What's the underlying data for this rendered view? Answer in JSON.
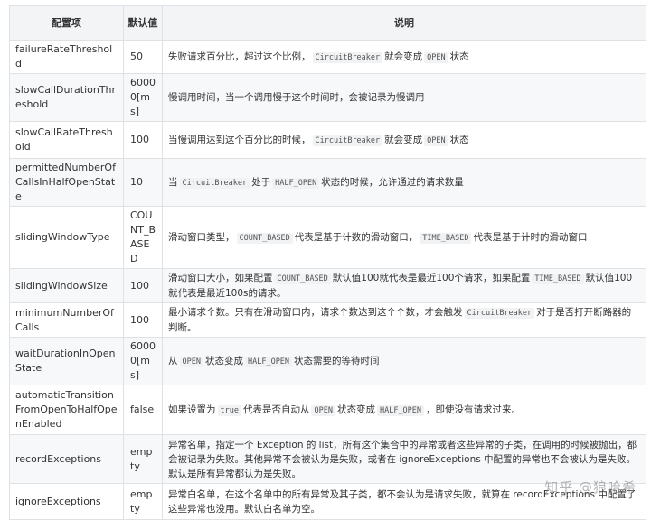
{
  "headers": {
    "name": "配置项",
    "default": "默认值",
    "desc": "说明"
  },
  "rows": [
    {
      "name": "failureRateThreshold",
      "default": "50",
      "desc": [
        {
          "t": "失败请求百分比，超过这个比例，"
        },
        {
          "c": "CircuitBreaker"
        },
        {
          "t": "就会变成"
        },
        {
          "c": "OPEN"
        },
        {
          "t": "状态"
        }
      ]
    },
    {
      "name": "slowCallDurationThreshold",
      "default": "60000[ms]",
      "desc": [
        {
          "t": "慢调用时间，当一个调用慢于这个时间时，会被记录为慢调用"
        }
      ]
    },
    {
      "name": "slowCallRateThreshold",
      "default": "100",
      "desc": [
        {
          "t": "当慢调用达到这个百分比的时候，"
        },
        {
          "c": "CircuitBreaker"
        },
        {
          "t": "就会变成"
        },
        {
          "c": "OPEN"
        },
        {
          "t": "状态"
        }
      ]
    },
    {
      "name": "permittedNumberOfCallsInHalfOpenState",
      "default": "10",
      "desc": [
        {
          "t": "当"
        },
        {
          "c": "CircuitBreaker"
        },
        {
          "t": "处于"
        },
        {
          "c": "HALF_OPEN"
        },
        {
          "t": "状态的时候，允许通过的请求数量"
        }
      ]
    },
    {
      "name": "slidingWindowType",
      "default": "COUNT_BASED",
      "desc": [
        {
          "t": "滑动窗口类型，"
        },
        {
          "c": "COUNT_BASED"
        },
        {
          "t": "代表是基于计数的滑动窗口，"
        },
        {
          "c": "TIME_BASED"
        },
        {
          "t": "代表是基于计时的滑动窗口"
        }
      ]
    },
    {
      "name": "slidingWindowSize",
      "default": "100",
      "desc": [
        {
          "t": "滑动窗口大小，如果配置"
        },
        {
          "c": "COUNT_BASED"
        },
        {
          "t": "默认值100就代表是最近100个请求，如果配置"
        },
        {
          "c": "TIME_BASED"
        },
        {
          "t": "默认值100就代表是最近100s的请求。"
        }
      ]
    },
    {
      "name": "minimumNumberOfCalls",
      "default": "100",
      "desc": [
        {
          "t": "最小请求个数。只有在滑动窗口内，请求个数达到这个个数，才会触发"
        },
        {
          "c": "CircuitBreaker"
        },
        {
          "t": "对于是否打开断路器的判断。"
        }
      ]
    },
    {
      "name": "waitDurationInOpenState",
      "default": "60000[ms]",
      "desc": [
        {
          "t": "从"
        },
        {
          "c": "OPEN"
        },
        {
          "t": "状态变成"
        },
        {
          "c": "HALF_OPEN"
        },
        {
          "t": "状态需要的等待时间"
        }
      ]
    },
    {
      "name": "automaticTransitionFromOpenToHalfOpenEnabled",
      "default": "false",
      "desc": [
        {
          "t": "如果设置为"
        },
        {
          "c": "true"
        },
        {
          "t": "代表是否自动从"
        },
        {
          "c": "OPEN"
        },
        {
          "t": "状态变成"
        },
        {
          "c": "HALF_OPEN"
        },
        {
          "t": "，即使没有请求过来。"
        }
      ]
    },
    {
      "name": "recordExceptions",
      "default": "empty",
      "desc": [
        {
          "t": "异常名单，指定一个 Exception 的 list，所有这个集合中的异常或者这些异常的子类，在调用的时候被抛出，都会被记录为失败。其他异常不会被认为是失败，或者在 ignoreExceptions 中配置的异常也不会被认为是失败。默认是所有异常都认为是失败。"
        }
      ]
    },
    {
      "name": "ignoreExceptions",
      "default": "empty",
      "desc": [
        {
          "t": "异常白名单，在这个名单中的所有异常及其子类，都不会认为是请求失败，就算在 recordExceptions 中配置了这些异常也没用。默认白名单为空。"
        }
      ]
    }
  ],
  "watermark": "知乎 @狼哈希"
}
